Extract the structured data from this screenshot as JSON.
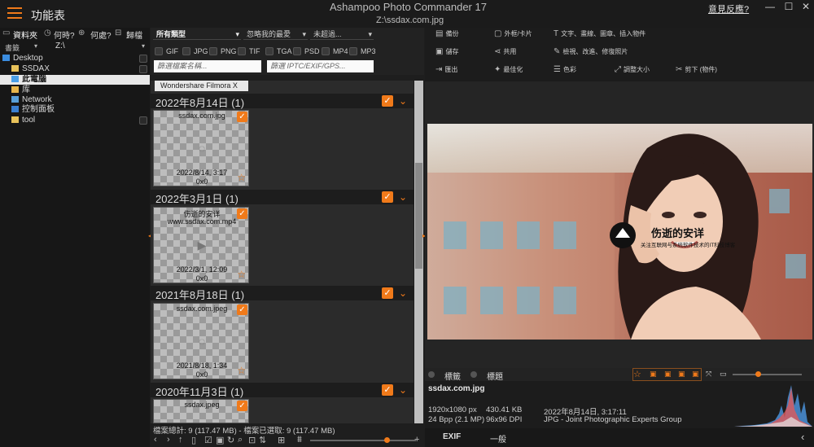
{
  "window": {
    "title": "Ashampoo Photo Commander 17",
    "file_path": "Z:\\ssdax.com.jpg",
    "menu_label": "功能表",
    "feedback": "意見反應?",
    "minimize": "—",
    "maximize": "☐",
    "close": "✕"
  },
  "left_panel": {
    "tabs": [
      "資料夾",
      "何時?",
      "何處?",
      "歸檔"
    ],
    "sort_label": "書籤",
    "location": "Z:\\",
    "tree": [
      {
        "label": "Desktop",
        "selected": false
      },
      {
        "label": "SSDAX",
        "selected": false
      },
      {
        "label": "此電腦",
        "selected": true
      },
      {
        "label": "库",
        "selected": false
      },
      {
        "label": "Network",
        "selected": false
      },
      {
        "label": "控制面板",
        "selected": false
      },
      {
        "label": "tool",
        "selected": false
      }
    ]
  },
  "filters": {
    "type_select": "所有類型",
    "rating_select": "忽略我的最愛",
    "size_select": "未超過...",
    "file_types": [
      "GIF",
      "JPG",
      "PNG",
      "TIF",
      "TGA",
      "PSD",
      "MP4",
      "MP3"
    ],
    "name_placeholder": "篩選檔案名稱...",
    "iptc_placeholder": "篩選 IPTC/EXIF/GPS..."
  },
  "grid": {
    "tab_label": "Wondershare Filmora X",
    "groups": [
      {
        "title": "2022年8月14日 (1)",
        "items": [
          {
            "name": "ssdax.com.jpg",
            "name2": "",
            "date": "2022/8/14, 3:17",
            "size": "0x0"
          }
        ]
      },
      {
        "title": "2022年3月1日 (1)",
        "items": [
          {
            "name": "伤逝的安详",
            "name2": "www.ssdax.com.mp4",
            "date": "2022/3/1, 12:09",
            "size": "0x0"
          }
        ]
      },
      {
        "title": "2021年8月18日 (1)",
        "items": [
          {
            "name": "ssdax.com.jpeg",
            "name2": "",
            "date": "2021/8/18, 1:34",
            "size": "0x0"
          }
        ]
      },
      {
        "title": "2020年11月3日 (1)",
        "items": [
          {
            "name": "ssdax.jpeg",
            "name2": "",
            "date": "",
            "size": ""
          }
        ]
      }
    ],
    "status": "檔案總計: 9 (117.47 MB) - 檔案已選取: 9 (117.47 MB)"
  },
  "toolbar": {
    "row1": [
      "備份",
      "外框/卡片",
      "文字、畫線、圖章、插入物件"
    ],
    "row2": [
      "儲存",
      "共用",
      "檢視、改進、修復照片"
    ],
    "row3": [
      "匯出",
      "最佳化",
      "色彩",
      "調整大小",
      "剪下 (物件)"
    ]
  },
  "photo": {
    "watermark_title": "伤逝的安详",
    "watermark_sub": "关注互联网与系统软件技术的IT科技博客"
  },
  "info": {
    "tabs": [
      "標籤",
      "標題"
    ],
    "filename": "ssdax.com.jpg",
    "dimensions": "1920x1080 px",
    "filesize": "430.41 KB",
    "date": "2022年8月14日, 3:17:11",
    "bpp": "24 Bpp (2.1 MP)",
    "dpi": "96x96 DPI",
    "format": "JPG - Joint Photographic Experts Group",
    "bottom_tabs": [
      "EXIF",
      "一般"
    ]
  },
  "colors": {
    "accent": "#f07a1a"
  }
}
